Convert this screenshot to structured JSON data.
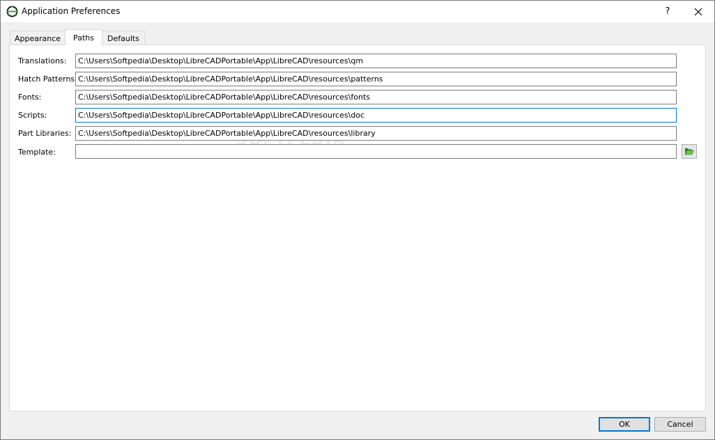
{
  "window": {
    "title": "Application Preferences",
    "help_label": "?",
    "close_label": "✕"
  },
  "tabs": [
    {
      "label": "Appearance"
    },
    {
      "label": "Paths"
    },
    {
      "label": "Defaults"
    }
  ],
  "paths": {
    "translations": {
      "label": "Translations:",
      "value": "C:\\Users\\Softpedia\\Desktop\\LibreCADPortable\\App\\LibreCAD\\resources\\qm"
    },
    "hatch_patterns": {
      "label": "Hatch Patterns:",
      "value": "C:\\Users\\Softpedia\\Desktop\\LibreCADPortable\\App\\LibreCAD\\resources\\patterns"
    },
    "fonts": {
      "label": "Fonts:",
      "value": "C:\\Users\\Softpedia\\Desktop\\LibreCADPortable\\App\\LibreCAD\\resources\\fonts"
    },
    "scripts": {
      "label": "Scripts:",
      "value": "C:\\Users\\Softpedia\\Desktop\\LibreCADPortable\\App\\LibreCAD\\resources\\doc"
    },
    "part_libraries": {
      "label": "Part Libraries:",
      "value": "C:\\Users\\Softpedia\\Desktop\\LibreCADPortable\\App\\LibreCAD\\resources\\library"
    },
    "template": {
      "label": "Template:",
      "value": ""
    }
  },
  "buttons": {
    "ok": "OK",
    "cancel": "Cancel"
  },
  "watermark": "SOFTPEDIA",
  "icons": {
    "app": "librecad-icon",
    "browse": "folder-open-icon"
  },
  "colors": {
    "accent": "#0078d7",
    "folder_green": "#3fa535"
  }
}
